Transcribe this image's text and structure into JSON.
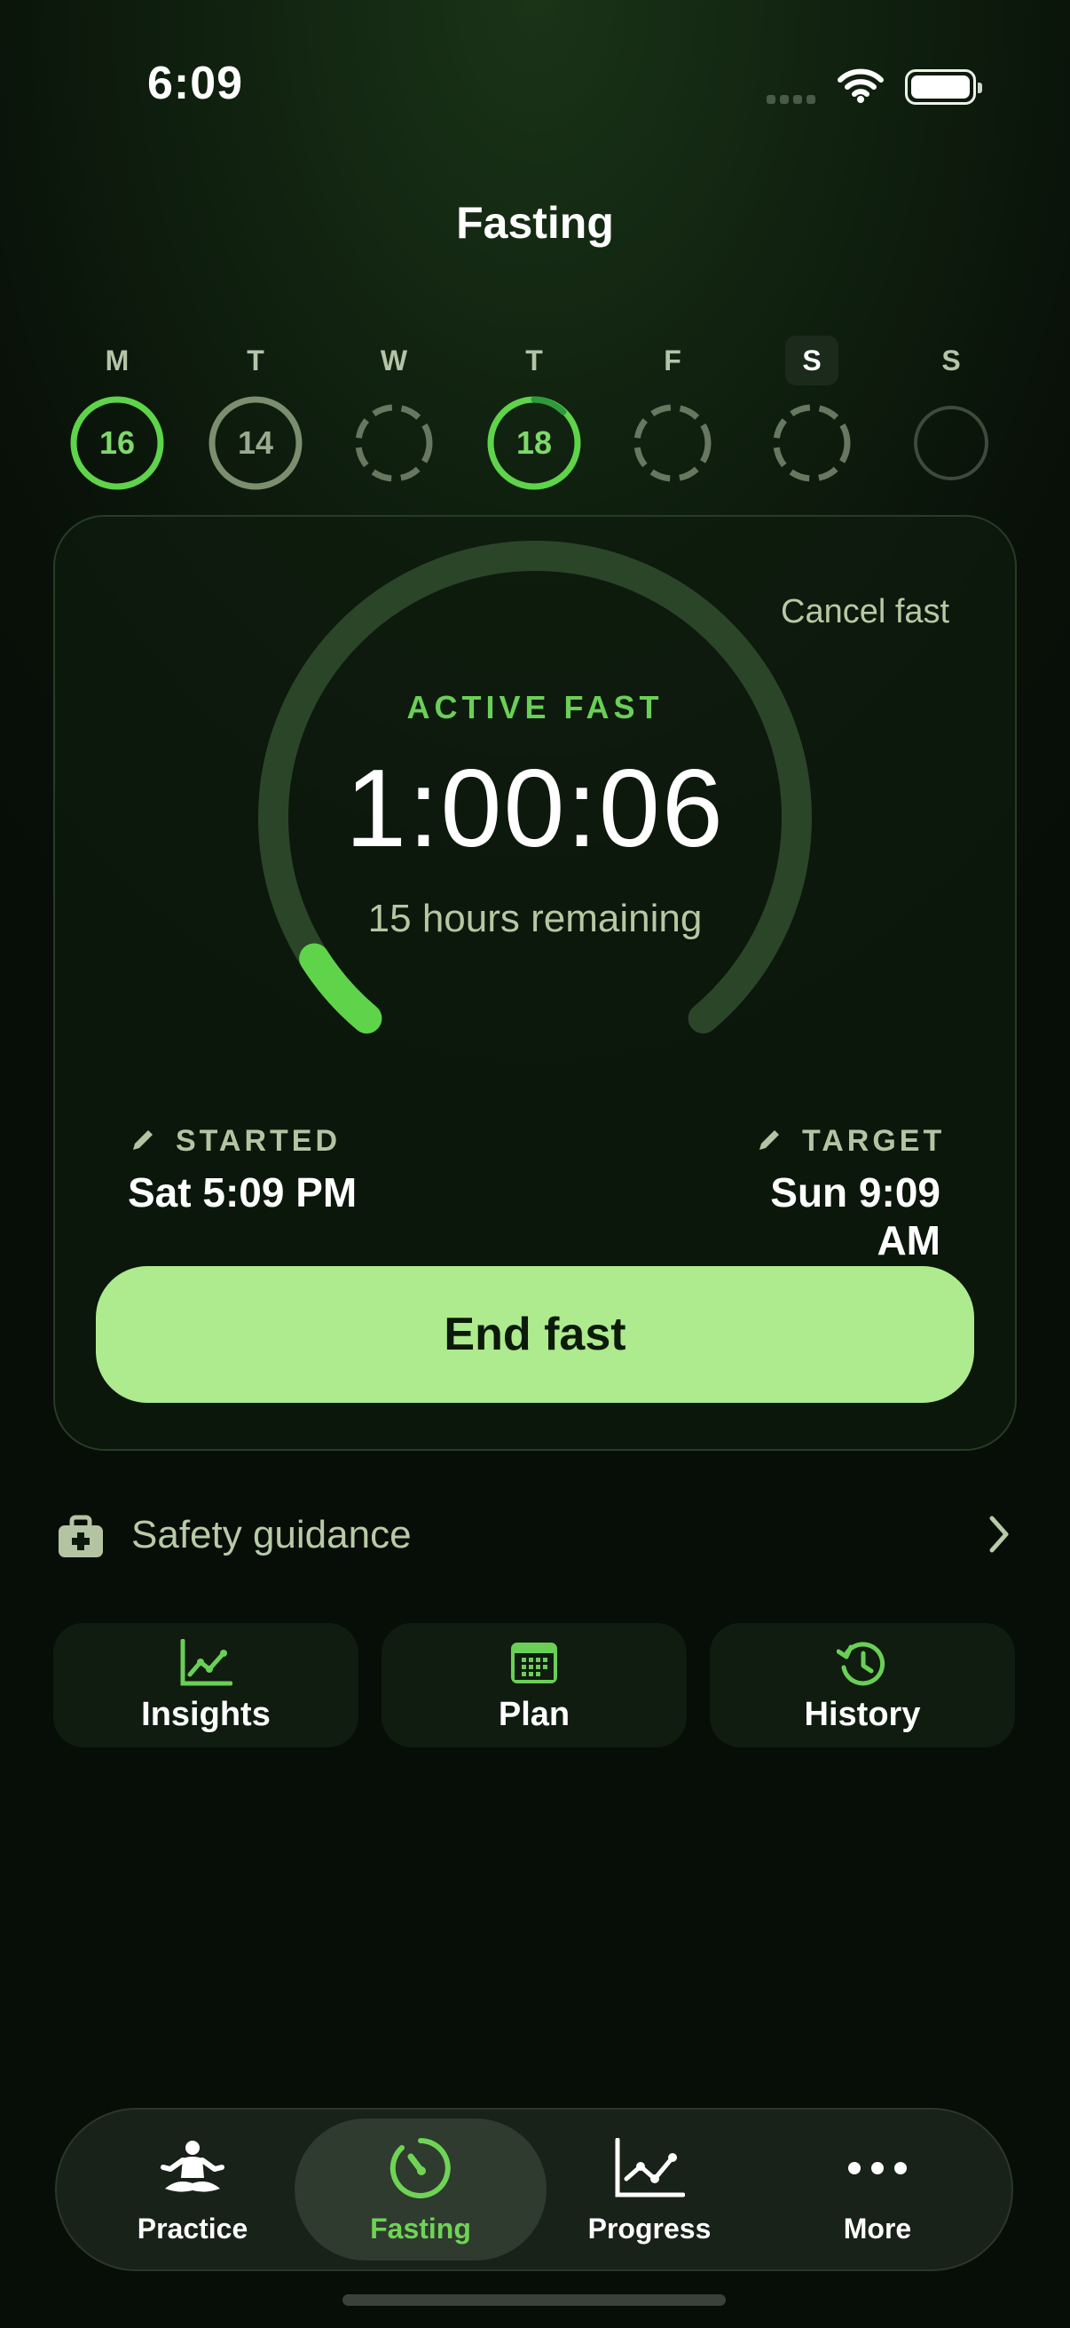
{
  "status_bar": {
    "time": "6:09"
  },
  "header": {
    "title": "Fasting"
  },
  "week": [
    {
      "letter": "M",
      "value": "16",
      "state": "complete",
      "today": false
    },
    {
      "letter": "T",
      "value": "14",
      "state": "partial",
      "today": false
    },
    {
      "letter": "W",
      "value": "",
      "state": "missed",
      "today": false
    },
    {
      "letter": "T",
      "value": "18",
      "state": "complete",
      "today": false
    },
    {
      "letter": "F",
      "value": "",
      "state": "missed",
      "today": false
    },
    {
      "letter": "S",
      "value": "",
      "state": "missed",
      "today": true
    },
    {
      "letter": "S",
      "value": "",
      "state": "empty",
      "today": false
    }
  ],
  "fast_card": {
    "cancel_label": "Cancel fast",
    "status_label": "ACTIVE FAST",
    "timer": "1:00:06",
    "remaining": "15 hours remaining",
    "progress_fraction": 0.0625,
    "started_label": "STARTED",
    "started_value": "Sat 5:09 PM",
    "target_label": "TARGET",
    "target_value": "Sun 9:09 AM",
    "end_button": "End fast"
  },
  "safety": {
    "label": "Safety guidance",
    "icon": "first-aid-kit-icon"
  },
  "quick_links": {
    "insights": "Insights",
    "plan": "Plan",
    "history": "History"
  },
  "tab_bar": {
    "practice": "Practice",
    "fasting": "Fasting",
    "progress": "Progress",
    "more": "More",
    "active": "fasting"
  },
  "colors": {
    "accent_green": "#6acf56",
    "button_green": "#aeea8e",
    "muted_text": "#b6c8a2",
    "ring_track": "#2d4a2a"
  }
}
